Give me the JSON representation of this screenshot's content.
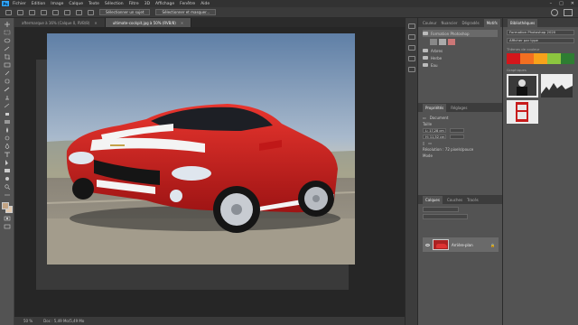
{
  "app": {
    "logo": "Ps",
    "menu": [
      "Fichier",
      "Edition",
      "Image",
      "Calque",
      "Texte",
      "Sélection",
      "Filtre",
      "3D",
      "Affichage",
      "Fenêtre",
      "Aide"
    ]
  },
  "options_bar": {
    "button_1": "Sélectionner un sujet",
    "button_2": "Sélectionner et masquer..."
  },
  "documents": {
    "tabs": [
      {
        "label": "aftermarque à 16% (Calque 0, RVB/8)",
        "active": false
      },
      {
        "label": "ultimate-cockpit.jpg à 50% (RVB/8)",
        "active": true
      }
    ]
  },
  "status": {
    "zoom": "50 %",
    "doc_size": "Doc : 5,49 Mo/5,49 Mo"
  },
  "bibliotheques_tabs": [
    "Couleur",
    "Nuancier",
    "Dégradés",
    "Motifs"
  ],
  "motifs_folders": [
    {
      "label": "Formation Photoshop",
      "selected": true
    },
    {
      "label": "Arbres",
      "selected": false
    },
    {
      "label": "Herbe",
      "selected": false
    },
    {
      "label": "Eau",
      "selected": false
    }
  ],
  "properties": {
    "tabs": [
      "Propriétés",
      "Réglages"
    ],
    "doc_label": "Document",
    "section": "Taille",
    "width": "L: 17,28 cm",
    "height": "H: 11,52 cm",
    "resolution": "Résolution : 72 pixels/pouce",
    "mode": "Mode"
  },
  "layers": {
    "tabs": [
      "Calques",
      "Couches",
      "Tracés"
    ],
    "layer_name": "Arrière-plan"
  },
  "libraries": {
    "title": "Bibliothèques",
    "selected_library": "Formation Photoshop 2020",
    "filter": "Afficher par type",
    "themes_label": "Thèmes de couleur",
    "images_label": "Graphiques",
    "theme_colors": [
      "#d4161b",
      "#f36f21",
      "#f7a21b",
      "#8cc63f",
      "#2e7d32"
    ]
  }
}
